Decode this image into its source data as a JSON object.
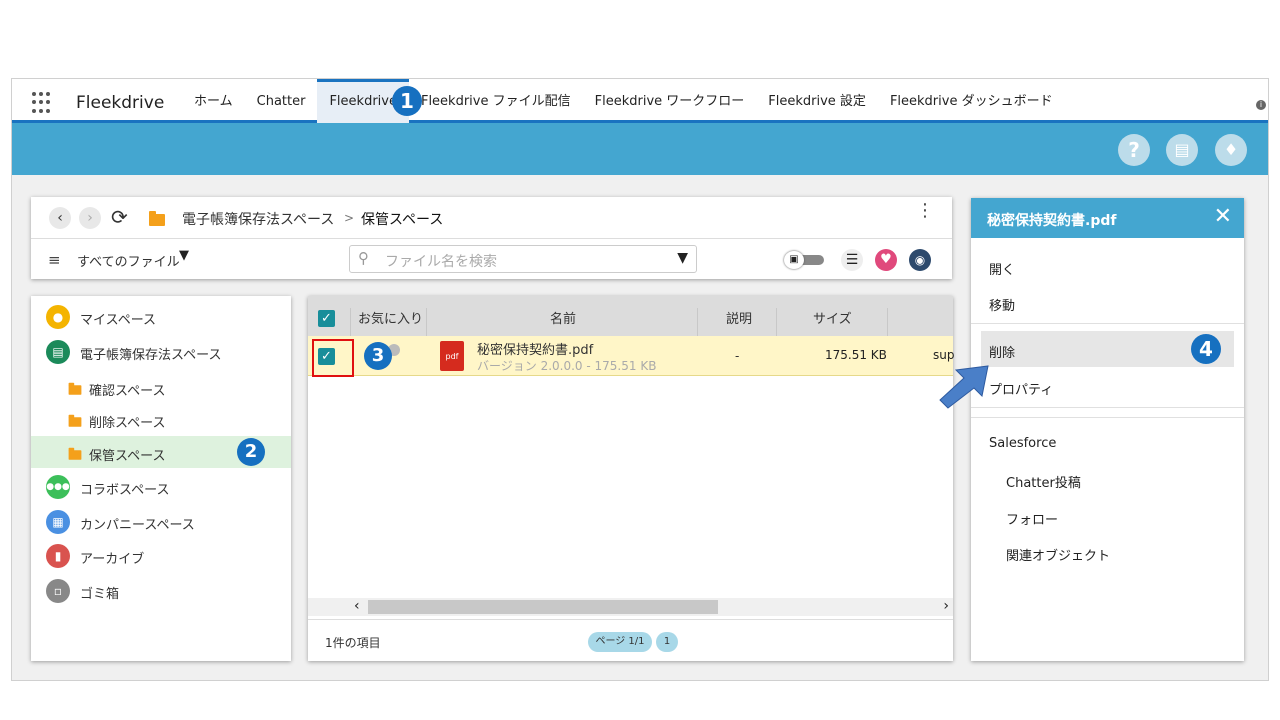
{
  "app": {
    "brand": "Fleekdrive",
    "tabs": [
      {
        "label": "ホーム"
      },
      {
        "label": "Chatter"
      },
      {
        "label": "Fleekdrive"
      },
      {
        "label": "Fleekdrive ファイル配信"
      },
      {
        "label": "Fleekdrive ワークフロー"
      },
      {
        "label": "Fleekdrive 設定"
      },
      {
        "label": "Fleekdrive ダッシュボード"
      }
    ],
    "header_icons": [
      "help-icon",
      "document-icon",
      "bell-icon"
    ]
  },
  "breadcrumb": {
    "parent": "電子帳簿保存法スペース",
    "separator": ">",
    "current": "保管スペース"
  },
  "filter": {
    "label": "すべてのファイル",
    "search_placeholder": "ファイル名を検索"
  },
  "tree": {
    "items": [
      {
        "label": "マイスペース",
        "icon": "user-icon",
        "color": "#f4b400"
      },
      {
        "label": "電子帳簿保存法スペース",
        "icon": "ledger-icon",
        "color": "#1b8a5a"
      },
      {
        "label": "確認スペース",
        "icon": "folder-icon"
      },
      {
        "label": "削除スペース",
        "icon": "folder-icon"
      },
      {
        "label": "保管スペース",
        "icon": "folder-icon"
      },
      {
        "label": "コラボスペース",
        "icon": "group-icon",
        "color": "#3cbf5a"
      },
      {
        "label": "カンパニースペース",
        "icon": "building-icon",
        "color": "#4a90e2"
      },
      {
        "label": "アーカイブ",
        "icon": "archive-icon",
        "color": "#d9534f"
      },
      {
        "label": "ゴミ箱",
        "icon": "trash-icon",
        "color": "#888888"
      }
    ]
  },
  "grid": {
    "columns": [
      "お気に入り",
      "名前",
      "説明",
      "サイズ"
    ],
    "rows": [
      {
        "name": "秘密保持契約書.pdf",
        "version": "バージョン 2.0.0.0 - 175.51 KB",
        "description": "-",
        "size": "175.51 KB",
        "owner": "sup",
        "icon_text": "pdf"
      }
    ],
    "footer": {
      "count": "1件の項目",
      "page_label": "ページ 1/1",
      "page_number": "1"
    }
  },
  "side_panel": {
    "title": "秘密保持契約書.pdf",
    "menu": [
      "開く",
      "移動",
      "削除",
      "プロパティ"
    ],
    "section_title": "Salesforce",
    "section_items": [
      "Chatter投稿",
      "フォロー",
      "関連オブジェクト"
    ]
  },
  "annotations": [
    "1",
    "2",
    "3",
    "4"
  ]
}
